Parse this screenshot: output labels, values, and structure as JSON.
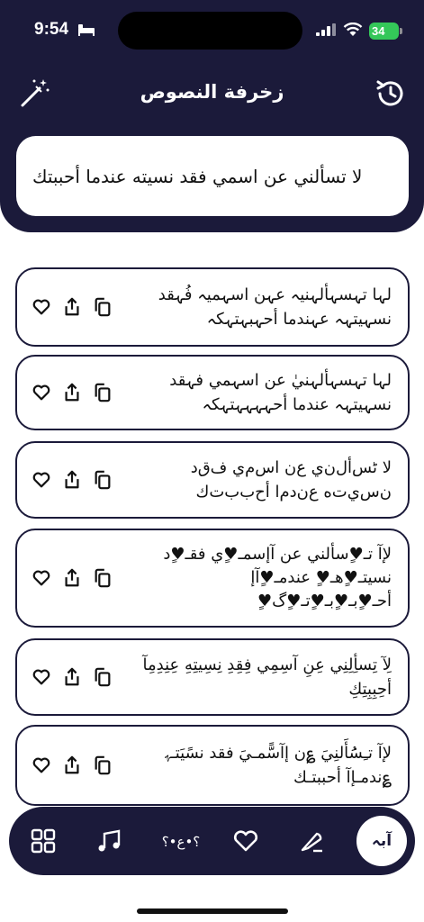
{
  "status_bar": {
    "time": "9:54",
    "battery": "34"
  },
  "header": {
    "title": "زخرفة النصوص",
    "left_icon": "magic-wand-icon",
    "right_icon": "history-icon"
  },
  "input": {
    "value": "لا تسألني عن اسمي فقد نسيته عندما أحببتك"
  },
  "results": [
    {
      "text": "لہا تہسہألہنیہ عہن اسہمیہ فُہقد نسہیتہہ عہندما أحہبہتہکہ"
    },
    {
      "text": "لہا تہسہألہنيٰ عن اسہمي فہقد نسہيتہہ عندما أحہہہہتہکہ"
    },
    {
      "text": "لا ٹس‌أل‌ن‌ي ع‌ن اس‌م‌ي ف‌ق‌د ن‌س‌ي‌ت‌ه ع‌ن‌د‌م‌ا أح‌ب‌ب‌ت‌ك"
    },
    {
      "text": "لإآ تـ♥ٍسألني عن آإسمـ♥ٍي فقـ♥ٍد نسيتـ♥ٍهـ♥ٍ عندمـ♥ٍآإ أحـ♥ٍبـ♥ٍبـ♥ٍتـ♥ٍگ♥ٍ"
    },
    {
      "text": "لِآ تِسأِلِنِي عِنِ آسِمِي فِقِدِ نِسِيتِهِ عِنِدِمِآ أحِبِبِتِكِ"
    },
    {
      "text": "لإآ تـِسَُأَلنِيَ ؏ن إآسًّمـيَ فقد نسًيَتـﮩ ؏ندمـإآ أحببتـك"
    }
  ],
  "nav": {
    "active_label": "آبہ",
    "items": [
      "grid-icon",
      "music-notes-icon",
      "decor-symbols-icon",
      "heart-icon",
      "feather-icon"
    ]
  },
  "colors": {
    "primary": "#1b1a3a",
    "background": "#ffffff"
  }
}
